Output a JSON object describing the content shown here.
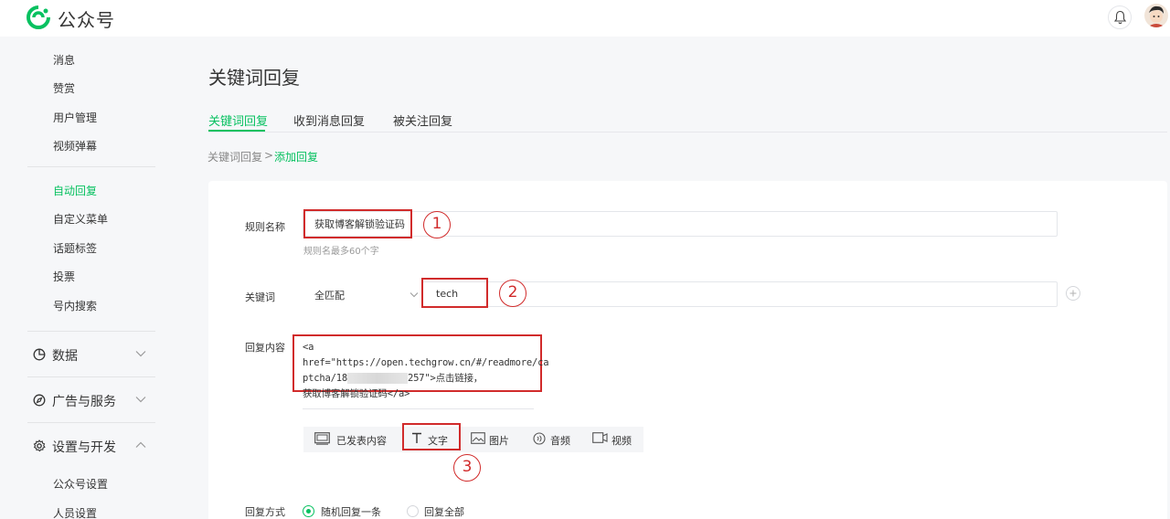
{
  "header": {
    "app_title": "公众号"
  },
  "sidebar": {
    "items": [
      {
        "label": "消息"
      },
      {
        "label": "赞赏"
      },
      {
        "label": "用户管理"
      },
      {
        "label": "视频弹幕"
      },
      {
        "label": "自动回复",
        "active": true
      },
      {
        "label": "自定义菜单"
      },
      {
        "label": "话题标签"
      },
      {
        "label": "投票"
      },
      {
        "label": "号内搜索"
      }
    ],
    "groups": [
      {
        "label": "数据",
        "icon": "chart-pie-icon",
        "expanded": false
      },
      {
        "label": "广告与服务",
        "icon": "compass-icon",
        "expanded": false
      },
      {
        "label": "设置与开发",
        "icon": "gear-icon",
        "expanded": true
      }
    ],
    "sub_items": [
      {
        "label": "公众号设置"
      },
      {
        "label": "人员设置"
      }
    ]
  },
  "page": {
    "title": "关键词回复",
    "tabs": [
      {
        "label": "关键词回复",
        "active": true
      },
      {
        "label": "收到消息回复"
      },
      {
        "label": "被关注回复"
      }
    ],
    "breadcrumb": {
      "parent": "关键词回复",
      "separator": ">",
      "current": "添加回复"
    }
  },
  "form": {
    "rule_name_label": "规则名称",
    "rule_name_value": "获取博客解锁验证码",
    "rule_name_hint": "规则名最多60个字",
    "keyword_label": "关键词",
    "match_mode": "全匹配",
    "keyword_value": "tech",
    "reply_label": "回复内容",
    "reply_line1": "<a href=\"https://open.techgrow.cn/#/readmore/ca",
    "reply_line2_start": "ptcha/18",
    "reply_line2_end": "257\">点击链接，",
    "reply_line3": "获取博客解锁验证码</a>",
    "media_types": [
      {
        "label": "已发表内容",
        "icon": "article-icon"
      },
      {
        "label": "文字",
        "icon": "text-icon",
        "selected": true
      },
      {
        "label": "图片",
        "icon": "image-icon"
      },
      {
        "label": "音频",
        "icon": "audio-icon"
      },
      {
        "label": "视频",
        "icon": "video-icon"
      }
    ],
    "reply_mode_label": "回复方式",
    "reply_modes": [
      {
        "label": "随机回复一条",
        "selected": true
      },
      {
        "label": "回复全部"
      }
    ]
  },
  "annotations": [
    "1",
    "2",
    "3"
  ],
  "colors": {
    "accent": "#07c160",
    "annotation": "#d12b2b"
  }
}
